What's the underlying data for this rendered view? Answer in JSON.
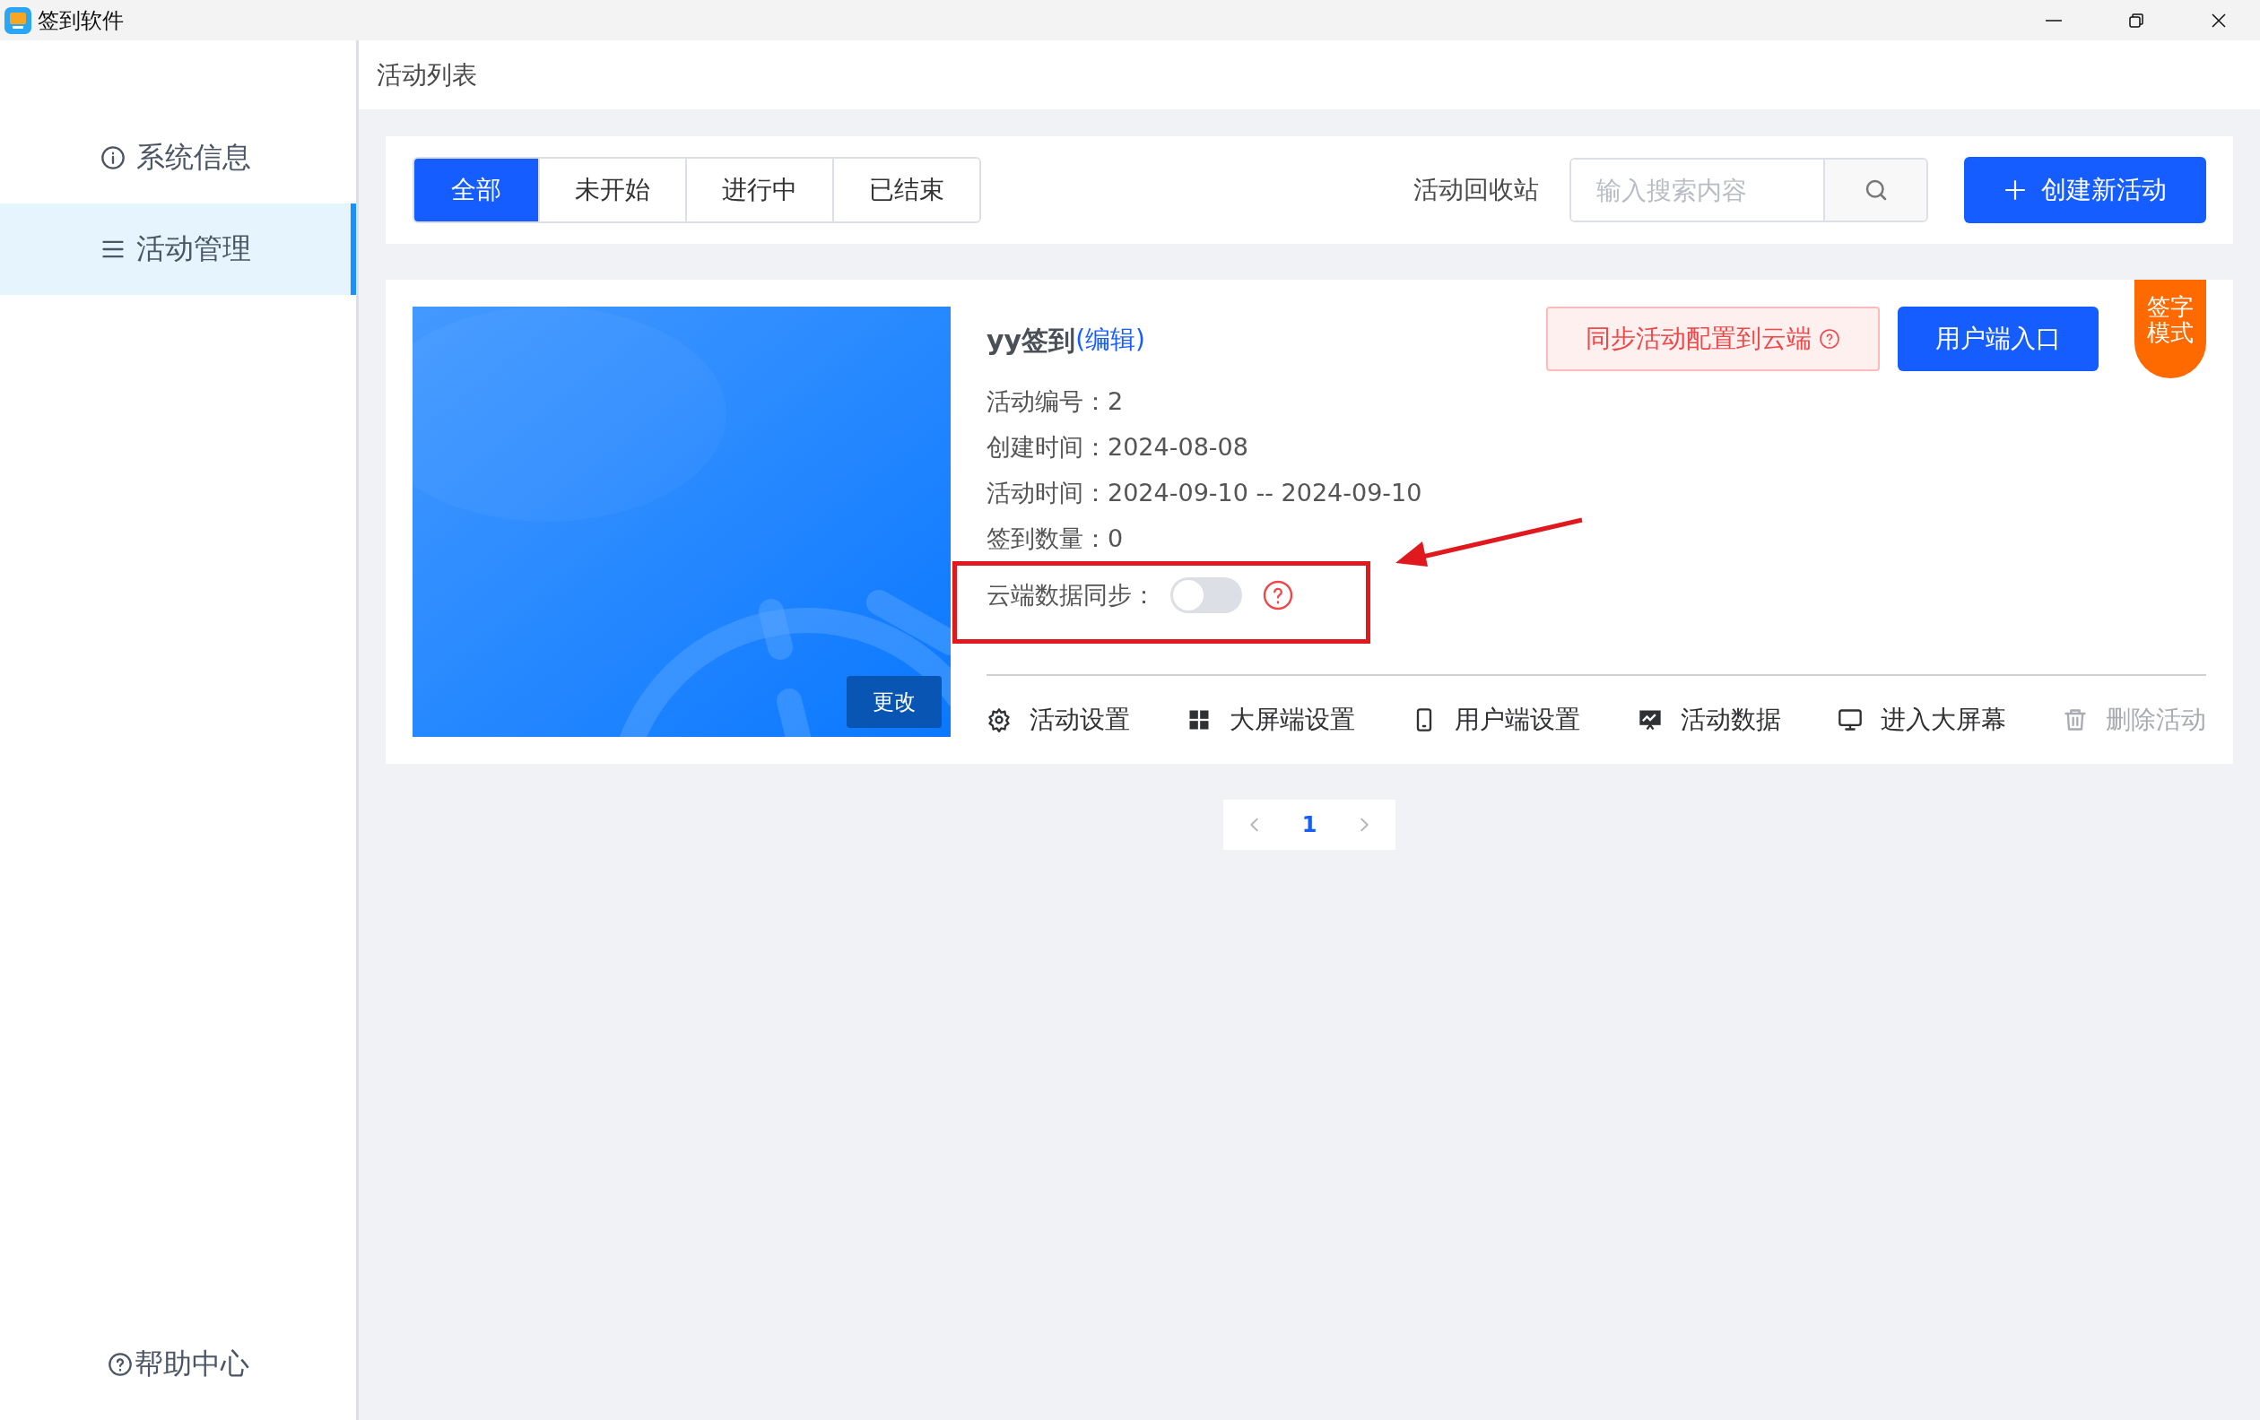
{
  "window": {
    "title": "签到软件"
  },
  "sidebar": {
    "items": [
      {
        "label": "系统信息",
        "selected": false
      },
      {
        "label": "活动管理",
        "selected": true
      }
    ],
    "help": "帮助中心"
  },
  "page_title": "活动列表",
  "filters": {
    "tabs": [
      {
        "label": "全部",
        "selected": true
      },
      {
        "label": "未开始",
        "selected": false
      },
      {
        "label": "进行中",
        "selected": false
      },
      {
        "label": "已结束",
        "selected": false
      }
    ],
    "recycle_bin": "活动回收站",
    "search": {
      "placeholder": "输入搜索内容"
    },
    "create_button": "创建新活动"
  },
  "activities": [
    {
      "name": "yy签到",
      "edit_link": "(编辑)",
      "change_button": "更改",
      "sync_button": "同步活动配置到云端",
      "entry_button": "用户端入口",
      "mode_badge": "签字模式",
      "fields": [
        {
          "label": "活动编号：",
          "value": "2"
        },
        {
          "label": "创建时间：",
          "value": "2024-08-08"
        },
        {
          "label": "活动时间：",
          "value": "2024-09-10 -- 2024-09-10"
        },
        {
          "label": "签到数量：",
          "value": "0"
        }
      ],
      "cloud_sync": {
        "label": "云端数据同步：",
        "on": false
      },
      "actions": [
        {
          "label": "活动设置",
          "disabled": false
        },
        {
          "label": "大屏端设置",
          "disabled": false
        },
        {
          "label": "用户端设置",
          "disabled": false
        },
        {
          "label": "活动数据",
          "disabled": false
        },
        {
          "label": "进入大屏幕",
          "disabled": false
        },
        {
          "label": "删除活动",
          "disabled": true
        }
      ]
    }
  ],
  "pagination": {
    "pages": [
      {
        "label": "1",
        "selected": true
      }
    ]
  }
}
